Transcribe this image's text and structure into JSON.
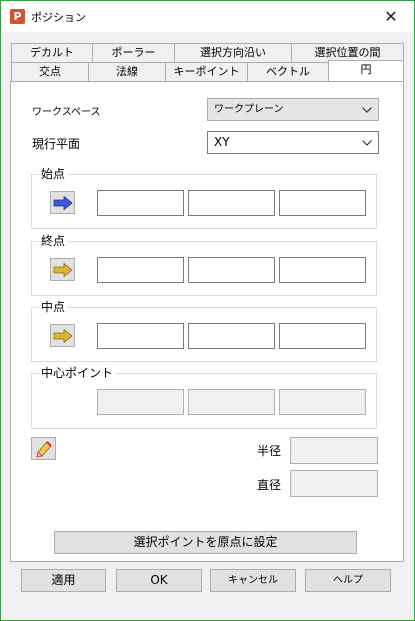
{
  "window": {
    "title": "ポジション",
    "close_glyph": "✕",
    "app_icon_letter": "P"
  },
  "tabs_row1": [
    "デカルト",
    "ポーラー",
    "選択方向沿い",
    "選択位置の間"
  ],
  "tabs_row2": [
    "交点",
    "法線",
    "キーポイント",
    "ベクトル",
    "円"
  ],
  "active_tab": "円",
  "workspace": {
    "label": "ワークスペース",
    "value": "ワークプレーン"
  },
  "current_plane": {
    "label": "現行平面",
    "value": "XY"
  },
  "groups": {
    "start": {
      "title": "始点",
      "arrow_color": "#3b5bdb"
    },
    "end": {
      "title": "終点",
      "arrow_color": "#c9a227"
    },
    "mid": {
      "title": "中点",
      "arrow_color": "#c9a227"
    },
    "center": {
      "title": "中心ポイント"
    }
  },
  "radius_label": "半径",
  "diameter_label": "直径",
  "set_origin_button": "選択ポイントを原点に設定",
  "buttons": {
    "apply": "適用",
    "ok": "OK",
    "cancel": "キャンセル",
    "help": "ヘルプ"
  }
}
